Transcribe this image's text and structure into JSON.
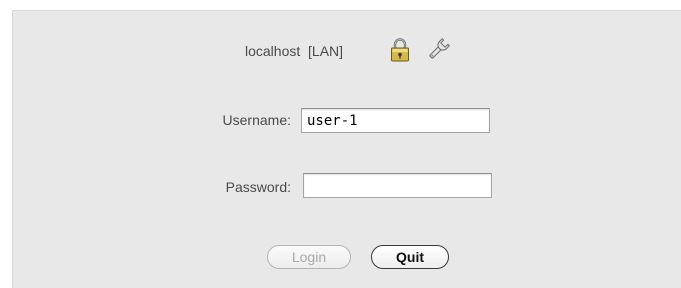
{
  "server": {
    "host": "localhost",
    "mode": "[LAN]",
    "lock_icon": "padlock-icon",
    "settings_icon": "wrench-icon"
  },
  "form": {
    "username_label": "Username:",
    "username_value": "user-1",
    "password_label": "Password:",
    "password_value": ""
  },
  "buttons": {
    "login_label": "Login",
    "login_enabled": false,
    "quit_label": "Quit"
  }
}
